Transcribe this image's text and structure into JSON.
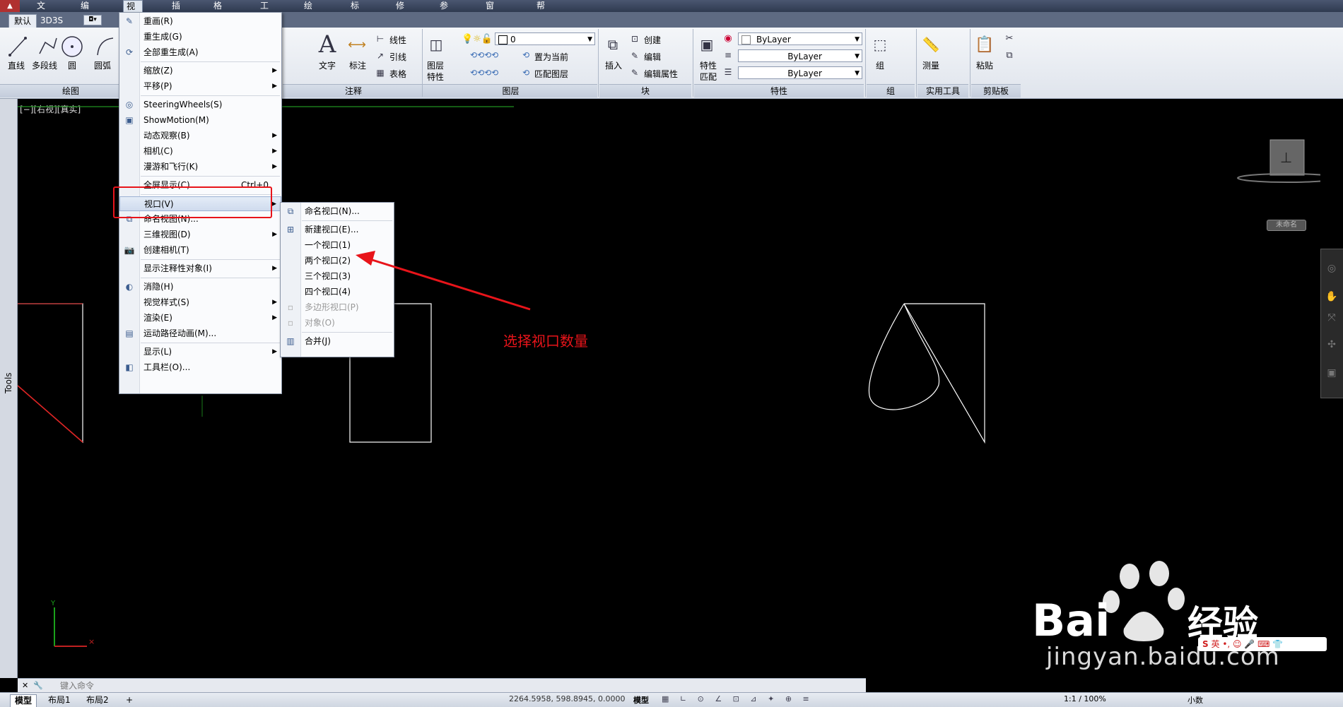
{
  "menubar": {
    "items": [
      "文件(F)",
      "编辑(E)",
      "视图(V)",
      "插入(I)",
      "格式(O)",
      "工具(T)",
      "绘图(D)",
      "标注(N)",
      "修改(M)",
      "参数(P)",
      "窗口(W)",
      "帮助(H)"
    ],
    "active_index": 2
  },
  "ribbon": {
    "tabs": [
      "默认",
      "3D3S"
    ],
    "draw_tools": [
      "直线",
      "多段线",
      "圆",
      "圆弧"
    ],
    "annot_tools": [
      "文字",
      "标注"
    ],
    "annot_small": [
      "线性",
      "引线",
      "表格"
    ],
    "layer_tools": [
      "图层",
      "特性"
    ],
    "layer_small": [
      "置为当前",
      "匹配图层"
    ],
    "layer_value": "0",
    "block_tools": [
      "插入"
    ],
    "block_small": [
      "创建",
      "编辑",
      "编辑属性"
    ],
    "prop_tools": [
      "特性",
      "匹配"
    ],
    "bylayer": [
      "ByLayer",
      "ByLayer",
      "ByLayer"
    ],
    "group_tools": [
      "组"
    ],
    "util_tools": [
      "测量"
    ],
    "clip_tools": [
      "粘贴"
    ],
    "panel_titles": [
      "绘图",
      "注释",
      "图层",
      "块",
      "特性",
      "组",
      "实用工具",
      "剪贴板"
    ]
  },
  "viewport": {
    "label": "[−][右视][真实]",
    "tools_label": "Tools",
    "named_box": "未命名"
  },
  "view_menu": {
    "items": [
      {
        "label": "重画(R)",
        "icon": "pencil-icon"
      },
      {
        "label": "重生成(G)",
        "icon": ""
      },
      {
        "label": "全部重生成(A)",
        "icon": "regen-icon"
      },
      {
        "label": "缩放(Z)",
        "sub": true
      },
      {
        "label": "平移(P)",
        "sub": true
      },
      {
        "label": "SteeringWheels(S)",
        "icon": "wheel-icon"
      },
      {
        "label": "ShowMotion(M)",
        "icon": "showmotion-icon"
      },
      {
        "label": "动态观察(B)",
        "sub": true
      },
      {
        "label": "相机(C)",
        "sub": true
      },
      {
        "label": "漫游和飞行(K)",
        "sub": true
      },
      {
        "label": "全屏显示(C)",
        "shortcut": "Ctrl+0"
      },
      {
        "label": "视口(V)",
        "sub": true,
        "highlight": true
      },
      {
        "label": "命名视图(N)...",
        "icon": "named-view-icon"
      },
      {
        "label": "三维视图(D)",
        "sub": true
      },
      {
        "label": "创建相机(T)",
        "icon": "camera-icon"
      },
      {
        "label": "显示注释性对象(I)",
        "sub": true
      },
      {
        "label": "消隐(H)",
        "icon": "hide-icon"
      },
      {
        "label": "视觉样式(S)",
        "sub": true
      },
      {
        "label": "渲染(E)",
        "sub": true
      },
      {
        "label": "运动路径动画(M)...",
        "icon": "film-icon"
      },
      {
        "label": "显示(L)",
        "sub": true
      },
      {
        "label": "工具栏(O)...",
        "icon": "toolbar-icon"
      }
    ]
  },
  "viewport_menu": {
    "items": [
      {
        "label": "命名视口(N)...",
        "icon": "named-viewport-icon"
      },
      {
        "label": "新建视口(E)...",
        "icon": "new-viewport-icon"
      },
      {
        "label": "一个视口(1)"
      },
      {
        "label": "两个视口(2)"
      },
      {
        "label": "三个视口(3)"
      },
      {
        "label": "四个视口(4)"
      },
      {
        "label": "多边形视口(P)",
        "disabled": true
      },
      {
        "label": "对象(O)",
        "disabled": true
      },
      {
        "label": "合并(J)",
        "icon": "join-icon"
      }
    ]
  },
  "annotation": {
    "text": "选择视口数量",
    "color": "#e8141a"
  },
  "command": {
    "placeholder": "键入命令"
  },
  "status": {
    "tabs": [
      "模型",
      "布局1",
      "布局2"
    ],
    "coords": "2264.5958, 598.8945, 0.0000",
    "model_label": "模型",
    "scale": "1:1 / 100%",
    "unit": "小数"
  },
  "watermark": {
    "brand": "Bai",
    "brand2": "经验",
    "url": "jingyan.baidu.com",
    "ime": "英"
  }
}
